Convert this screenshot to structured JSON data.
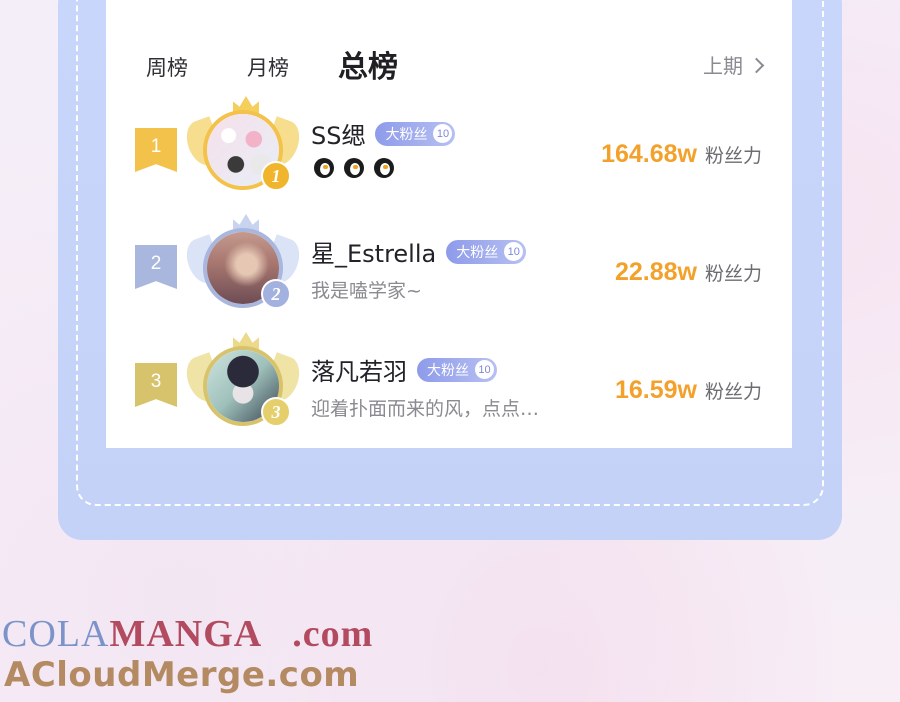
{
  "tabs": {
    "week": "周榜",
    "month": "月榜",
    "total": "总榜",
    "active": "总榜"
  },
  "previous_period": "上期",
  "fan_badge_label": "大粉丝",
  "score_unit": "粉丝力",
  "colors": {
    "accent_orange": "#f3a12b",
    "badge_purple": "#8e9bea",
    "frame_blue": "#c9d6fb",
    "gold": "#f2c24a",
    "silver": "#a9b6de",
    "bronze": "#d8c36d"
  },
  "rankings": [
    {
      "rank": "1",
      "place": "1",
      "name": "SS缌",
      "badge_level": "10",
      "subtitle": "",
      "icons": [
        "penguin-icon",
        "penguin-icon",
        "penguin-icon"
      ],
      "score": "164.68w"
    },
    {
      "rank": "2",
      "place": "2",
      "name": "星_Estrella",
      "badge_level": "10",
      "subtitle": "我是嗑学家~",
      "score": "22.88w"
    },
    {
      "rank": "3",
      "place": "3",
      "name": "落凡若羽",
      "badge_level": "10",
      "subtitle": "迎着扑面而来的风，点点…",
      "score": "16.59w"
    }
  ],
  "watermark": {
    "line1_part1": "COLA",
    "line1_part2": "MANGA",
    "line1_part3": ".com",
    "line2": "ACloudMerge.com"
  }
}
